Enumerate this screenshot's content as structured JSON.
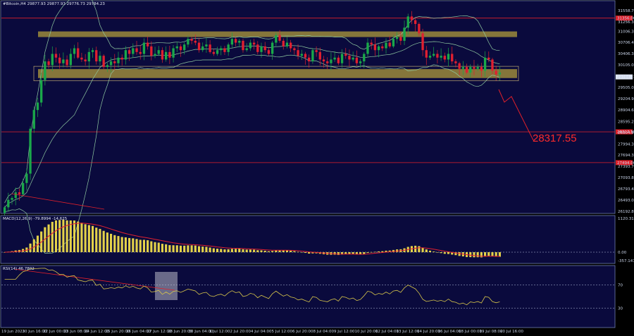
{
  "header": {
    "symbol": "#Bitcoin,H4  29877.93 29877.93 29776.73 29784.23",
    "macd": "MACD(12,26,9) -79.8994 -14.625",
    "rsi": "RSI(14) 46.7802"
  },
  "colors": {
    "background": "#0a0a3d",
    "frame": "#6f7fae",
    "bull_candle": "#1aa84a",
    "bear_candle": "#e02030",
    "bollinger": "#8fc9a0",
    "zone": "#b6a13a",
    "resistance_line": "#e0202a",
    "macd_hist": "#e4d24a",
    "macd_signal": "#e02030",
    "rsi_line": "#d8c64a",
    "divergence": "#e0202a",
    "target_text": "#ff2a2a"
  },
  "chart_data": [
    {
      "type": "candlestick",
      "panel": "price",
      "ylim": [
        26192.8,
        31726.9
      ],
      "y_tick_labels": [
        "31558.70",
        "31256.30",
        "31006.30",
        "30706.40",
        "30406.30",
        "30105.00",
        "29505.00",
        "29204.90",
        "28904.60",
        "28595.20",
        "28304.90",
        "27994.30",
        "27694.30",
        "27393.70",
        "27093.80",
        "26793.40",
        "26493.00",
        "26192.80"
      ],
      "x_tick_labels": [
        "19 Jun 2023",
        "20 Jun 16:00",
        "22 Jun 00:00",
        "23 Jun 08:00",
        "24 Jun 12:00",
        "25 Jun 20:00",
        "26 Jun 04:00",
        "27 Jun 12:00",
        "28 Jun 20:00",
        "30 Jun 04:00",
        "1 Jul 12:00",
        "2 Jul 20:00",
        "4 Jul 04:00",
        "5 Jul 12:00",
        "6 Jul 20:00",
        "8 Jul 04:00",
        "9 Jul 12:00",
        "10 Jul 20:00",
        "12 Jul 04:00",
        "13 Jul 12:00",
        "14 Jul 20:00",
        "16 Jul 04:00",
        "18 Jul 00:00",
        "19 Jul 08:00",
        "20 Jul 16:00"
      ],
      "x_tick_count": 25,
      "series": [
        {
          "name": "",
          "close": [
            26300,
            26500,
            26550,
            26700,
            26650,
            26950,
            27200,
            28400,
            28900,
            29100,
            29700,
            30200,
            30100,
            30400,
            30300,
            30150,
            30250,
            30100,
            30400,
            30550,
            30300,
            30250,
            30200,
            30450,
            30500,
            30200,
            30350,
            30050,
            30100,
            30200,
            30150,
            30300,
            30250,
            30500,
            30400,
            30550,
            30450,
            30400,
            30700,
            30600,
            30350,
            30400,
            30500,
            30250,
            30450,
            30300,
            30550,
            30600,
            30500,
            30650,
            30800,
            30750,
            30700,
            30500,
            30600,
            30650,
            30450,
            30400,
            30500,
            30550,
            30450,
            30650,
            30800,
            30700,
            30750,
            30500,
            30550,
            30700,
            30650,
            30450,
            30600,
            30500,
            30400,
            30700,
            30900,
            30750,
            30600,
            30700,
            30550,
            30500,
            30350,
            30400,
            30300,
            30200,
            30500,
            30450,
            30250,
            30200,
            30150,
            30250,
            30300,
            30150,
            30400,
            30350,
            30250,
            30300,
            30150,
            30200,
            30400,
            30700,
            30650,
            30500,
            30600,
            30550,
            30700,
            30600,
            30800,
            30850,
            30750,
            31100,
            31400,
            31300,
            31200,
            30950,
            30500,
            30300,
            30350,
            30400,
            30300,
            30350,
            30250,
            30400,
            30200,
            30150,
            30000,
            30050,
            29900,
            30050,
            30000,
            30050,
            29950,
            30300,
            30250,
            29950,
            29850,
            29900
          ]
        }
      ],
      "horizontal_levels": [
        31356,
        28317.55,
        27494
      ],
      "zones": [
        {
          "top": 31000,
          "bottom": 30850
        },
        {
          "top": 29993,
          "bottom": 29755
        }
      ],
      "target_label": "28317.55",
      "badges": [
        "31356.00",
        "29784.23",
        "28317.55",
        "27494.00"
      ]
    },
    {
      "type": "bar",
      "panel": "macd",
      "y_tick_labels": [
        "1120.314",
        "0.00",
        "-357.147"
      ],
      "series_names": [
        "",
        ""
      ]
    },
    {
      "type": "line",
      "panel": "rsi",
      "ylim": [
        0,
        100
      ],
      "levels": [
        70,
        30
      ],
      "y_tick_labels": [
        "70",
        "30"
      ]
    }
  ]
}
